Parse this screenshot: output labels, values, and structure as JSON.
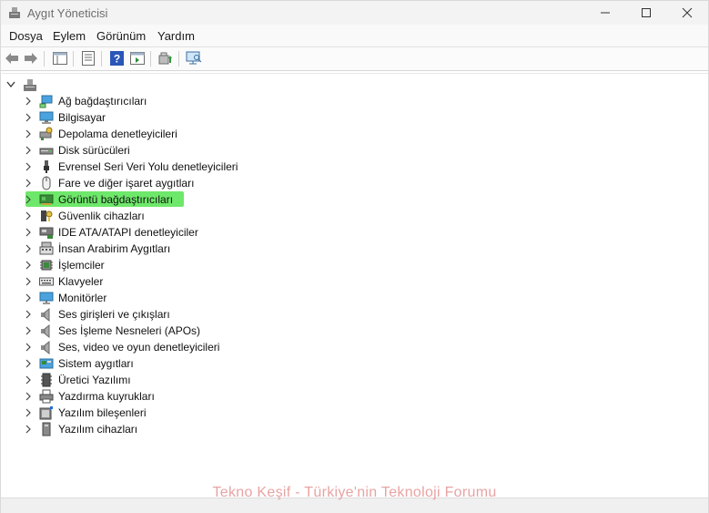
{
  "window": {
    "title": "Aygıt Yöneticisi"
  },
  "menu": [
    {
      "label": "Dosya"
    },
    {
      "label": "Eylem"
    },
    {
      "label": "Görünüm"
    },
    {
      "label": "Yardım"
    }
  ],
  "tree": {
    "items": [
      {
        "label": "Ağ bağdaştırıcıları",
        "icon": "network-adapter-icon"
      },
      {
        "label": "Bilgisayar",
        "icon": "computer-icon"
      },
      {
        "label": "Depolama denetleyicileri",
        "icon": "storage-controller-icon"
      },
      {
        "label": "Disk sürücüleri",
        "icon": "disk-drive-icon"
      },
      {
        "label": "Evrensel Seri Veri Yolu denetleyicileri",
        "icon": "usb-icon"
      },
      {
        "label": "Fare ve diğer işaret aygıtları",
        "icon": "mouse-icon"
      },
      {
        "label": "Görüntü bağdaştırıcıları",
        "icon": "display-adapter-icon",
        "highlighted": true
      },
      {
        "label": "Güvenlik cihazları",
        "icon": "security-device-icon"
      },
      {
        "label": "IDE ATA/ATAPI denetleyiciler",
        "icon": "ide-controller-icon"
      },
      {
        "label": "İnsan Arabirim Aygıtları",
        "icon": "hid-icon"
      },
      {
        "label": "İşlemciler",
        "icon": "processor-icon"
      },
      {
        "label": "Klavyeler",
        "icon": "keyboard-icon"
      },
      {
        "label": "Monitörler",
        "icon": "monitor-icon"
      },
      {
        "label": "Ses girişleri ve çıkışları",
        "icon": "speaker-icon"
      },
      {
        "label": "Ses İşleme Nesneleri (APOs)",
        "icon": "speaker-icon"
      },
      {
        "label": "Ses, video ve oyun denetleyicileri",
        "icon": "speaker-icon"
      },
      {
        "label": "Sistem aygıtları",
        "icon": "system-device-icon"
      },
      {
        "label": "Üretici Yazılımı",
        "icon": "firmware-icon"
      },
      {
        "label": "Yazdırma kuyrukları",
        "icon": "printer-icon"
      },
      {
        "label": "Yazılım bileşenleri",
        "icon": "software-component-icon"
      },
      {
        "label": "Yazılım cihazları",
        "icon": "software-device-icon"
      }
    ]
  },
  "watermark": "Tekno Keşif - Türkiye'nin Teknoloji Forumu",
  "colors": {
    "highlight": "#6ee86a",
    "watermark": "#e8a3a3"
  }
}
